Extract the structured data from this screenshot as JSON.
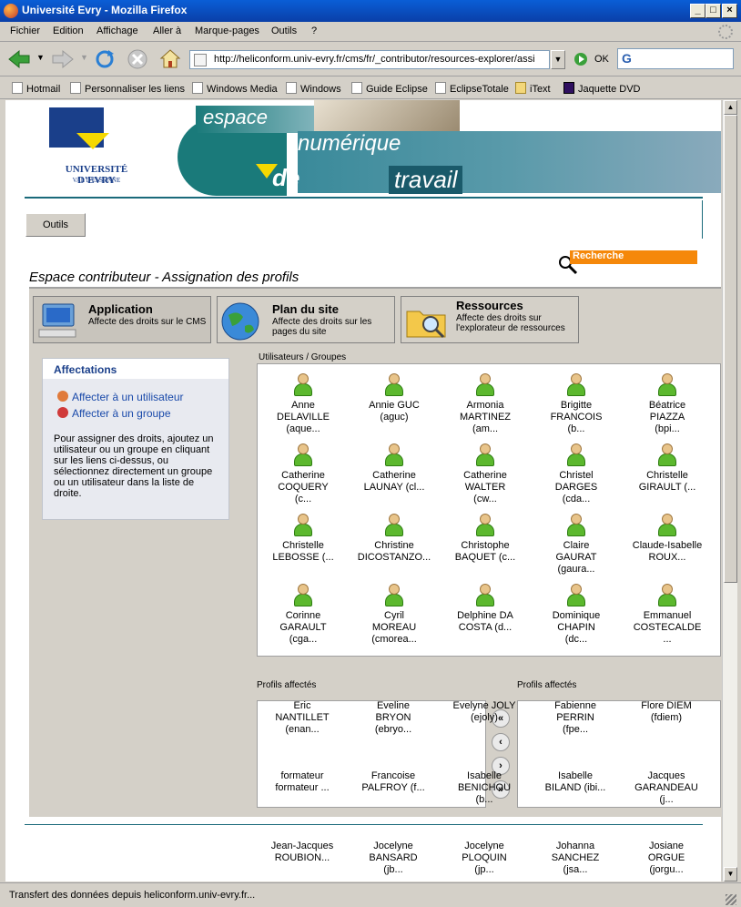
{
  "window": {
    "title": "Université Evry - Mozilla Firefox"
  },
  "menubar": [
    "Fichier",
    "Edition",
    "Affichage",
    "Marque-pages",
    "Outils",
    "?"
  ],
  "nav": {
    "url": "http://heliconform.univ-evry.fr/cms/fr/_contributor/resources-explorer/assi",
    "ok_label": "OK"
  },
  "bookmarks": [
    "Hotmail",
    "Personnaliser les liens",
    "Windows Media",
    "Windows",
    "Guide Eclipse",
    "EclipseTotale",
    "iText",
    "Jaquette DVD"
  ],
  "banner": {
    "univ_line1": "UNIVERSITÉ D'EVRY",
    "univ_line2": "VAL D'ESSONNE",
    "word1": "espace",
    "word2": "numérique",
    "word3": "de",
    "word4": "travail"
  },
  "outils_label": "Outils",
  "search_label": "Recherche",
  "page_title": "Espace contributeur - Assignation des profils",
  "tabs": [
    {
      "title": "Application",
      "desc": "Affecte des droits sur le CMS",
      "icon": "computer-icon"
    },
    {
      "title": "Plan du site",
      "desc": "Affecte des droits sur les pages du site",
      "icon": "globe-icon"
    },
    {
      "title": "Ressources",
      "desc": "Affecte des droits sur l'explorateur de ressources",
      "icon": "folder-search-icon"
    }
  ],
  "affectations": {
    "title": "Affectations",
    "link_user": "Affecter à un utilisateur",
    "link_group": "Affecter à un groupe",
    "help": "Pour assigner des droits, ajoutez un utilisateur ou un groupe en cliquant sur les liens ci-dessus, ou sélectionnez directement un groupe ou un utilisateur dans la liste de droite."
  },
  "users_header": "Utilisateurs / Groupes",
  "users": [
    [
      "Anne",
      "DELAVILLE",
      "(aque..."
    ],
    [
      "Annie GUC",
      "(aguc)",
      ""
    ],
    [
      "Armonia",
      "MARTINEZ",
      "(am..."
    ],
    [
      "Brigitte",
      "FRANCOIS",
      "(b..."
    ],
    [
      "Béatrice",
      "PIAZZA",
      "(bpi..."
    ],
    [
      "Catherine",
      "COQUERY",
      "(c..."
    ],
    [
      "Catherine",
      "LAUNAY (cl...",
      ""
    ],
    [
      "Catherine",
      "WALTER",
      "(cw..."
    ],
    [
      "Christel",
      "DARGES",
      "(cda..."
    ],
    [
      "Christelle",
      "GIRAULT (...",
      ""
    ],
    [
      "Christelle",
      "LEBOSSE (...",
      ""
    ],
    [
      "Christine",
      "DICOSTANZO...",
      ""
    ],
    [
      "Christophe",
      "BAQUET (c...",
      ""
    ],
    [
      "Claire",
      "GAURAT",
      "(gaura..."
    ],
    [
      "Claude-Isabelle",
      "ROUX...",
      ""
    ],
    [
      "Corinne",
      "GARAULT",
      "(cga..."
    ],
    [
      "Cyril",
      "MOREAU",
      "(cmorea..."
    ],
    [
      "Delphine DA",
      "COSTA (d...",
      ""
    ],
    [
      "Dominique",
      "CHAPIN",
      "(dc..."
    ],
    [
      "Emmanuel",
      "COSTECALDE",
      "..."
    ]
  ],
  "overflow_users": [
    [
      "Eric",
      "NANTILLET",
      "(enan..."
    ],
    [
      "Eveline",
      "BRYON",
      "(ebryo..."
    ],
    [
      "Evelyne JOLY",
      "(ejoly)",
      ""
    ],
    [
      "Fabienne",
      "PERRIN",
      "(fpe..."
    ],
    [
      "Flore DIEM",
      "(fdiem)",
      ""
    ],
    [
      "formateur",
      "formateur ...",
      ""
    ],
    [
      "Francoise",
      "PALFROY (f...",
      ""
    ],
    [
      "Isabelle",
      "BENICHOU",
      "(b..."
    ],
    [
      "Isabelle",
      "BILAND (ibi...",
      ""
    ],
    [
      "Jacques",
      "GARANDEAU",
      "(j..."
    ],
    [
      "Jean-Jacques",
      "ROUBION...",
      ""
    ],
    [
      "Jocelyne",
      "BANSARD",
      "(jb..."
    ],
    [
      "Jocelyne",
      "PLOQUIN",
      "(jp..."
    ],
    [
      "Johanna",
      "SANCHEZ",
      "(jsa..."
    ],
    [
      "Josiane",
      "ORGUE",
      "(jorgu..."
    ]
  ],
  "profiles": {
    "affected_label": "Profils affectés",
    "available_label": "Profils affectés"
  },
  "status": "Transfert des données depuis heliconform.univ-evry.fr..."
}
